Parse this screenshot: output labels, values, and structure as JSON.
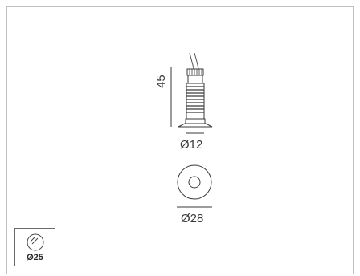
{
  "dimensions": {
    "height_label": "45",
    "body_diameter_label": "Ø12",
    "flange_diameter_label": "Ø28"
  },
  "cutout_badge": {
    "icon": "cutout-hole-icon",
    "label": "Ø25"
  },
  "colors": {
    "line": "#3a3a3a",
    "frame": "#bfbfbf"
  }
}
